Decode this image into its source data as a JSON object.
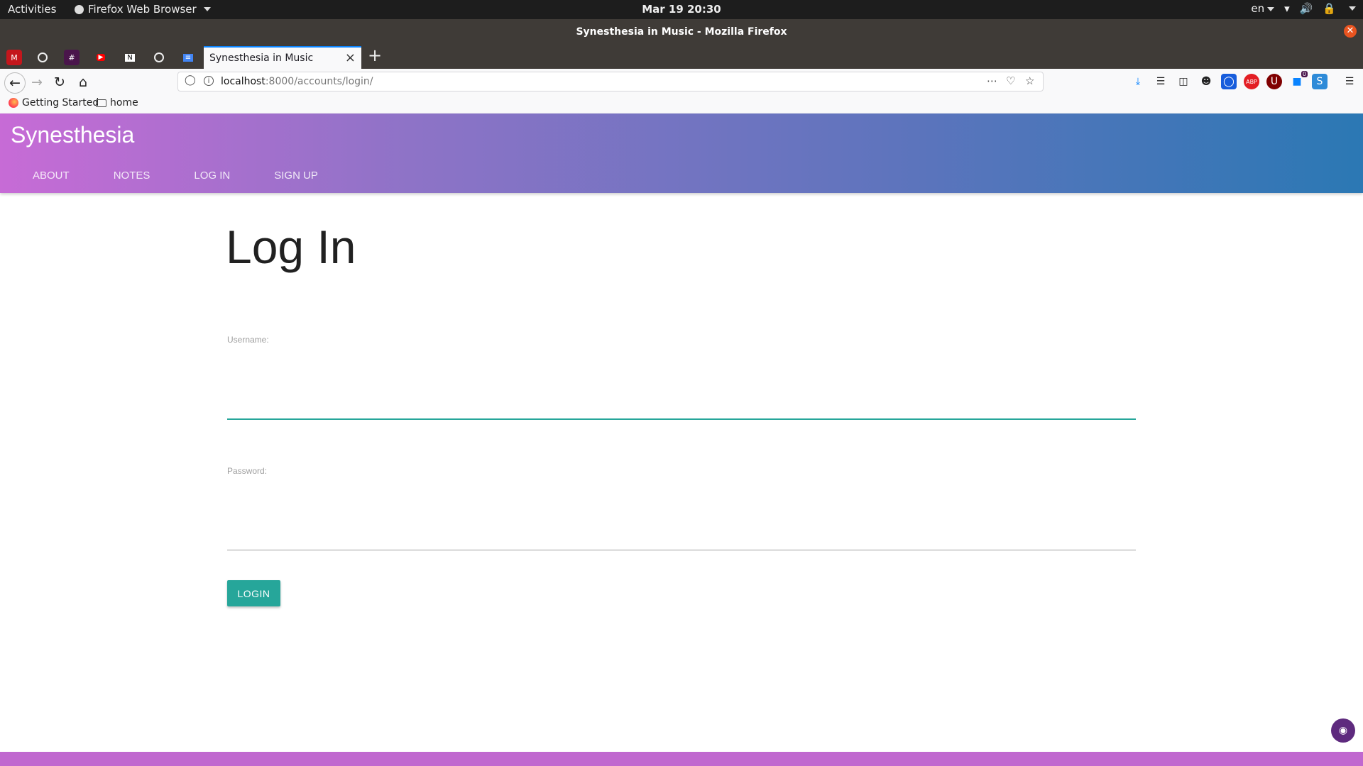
{
  "system": {
    "activities": "Activities",
    "app_menu": "Firefox Web Browser",
    "clock": "Mar 19  20:30",
    "lang": "en"
  },
  "window": {
    "title": "Synesthesia in Music - Mozilla Firefox"
  },
  "tabs": {
    "pinned": [
      "gmail-icon",
      "github-icon",
      "slack-icon",
      "youtube-icon",
      "notion-icon",
      "github-icon",
      "docs-icon"
    ],
    "active_label": "Synesthesia in Music"
  },
  "navbar": {
    "url_host": "localhost",
    "url_rest": ":8000/accounts/login/",
    "badge_count": "0"
  },
  "bookmarks": [
    {
      "label": "Getting Started",
      "icon": "firefox-icon"
    },
    {
      "label": "home",
      "icon": "folder-icon"
    }
  ],
  "site": {
    "brand": "Synesthesia",
    "nav": [
      "ABOUT",
      "NOTES",
      "LOG IN",
      "SIGN UP"
    ]
  },
  "form": {
    "title": "Log In",
    "username_label": "Username:",
    "username_value": "",
    "password_label": "Password:",
    "password_value": "",
    "submit_label": "LOGIN"
  },
  "colors": {
    "accent": "#26a69a",
    "header_start": "#c76bd6",
    "header_end": "#2b78b4"
  }
}
